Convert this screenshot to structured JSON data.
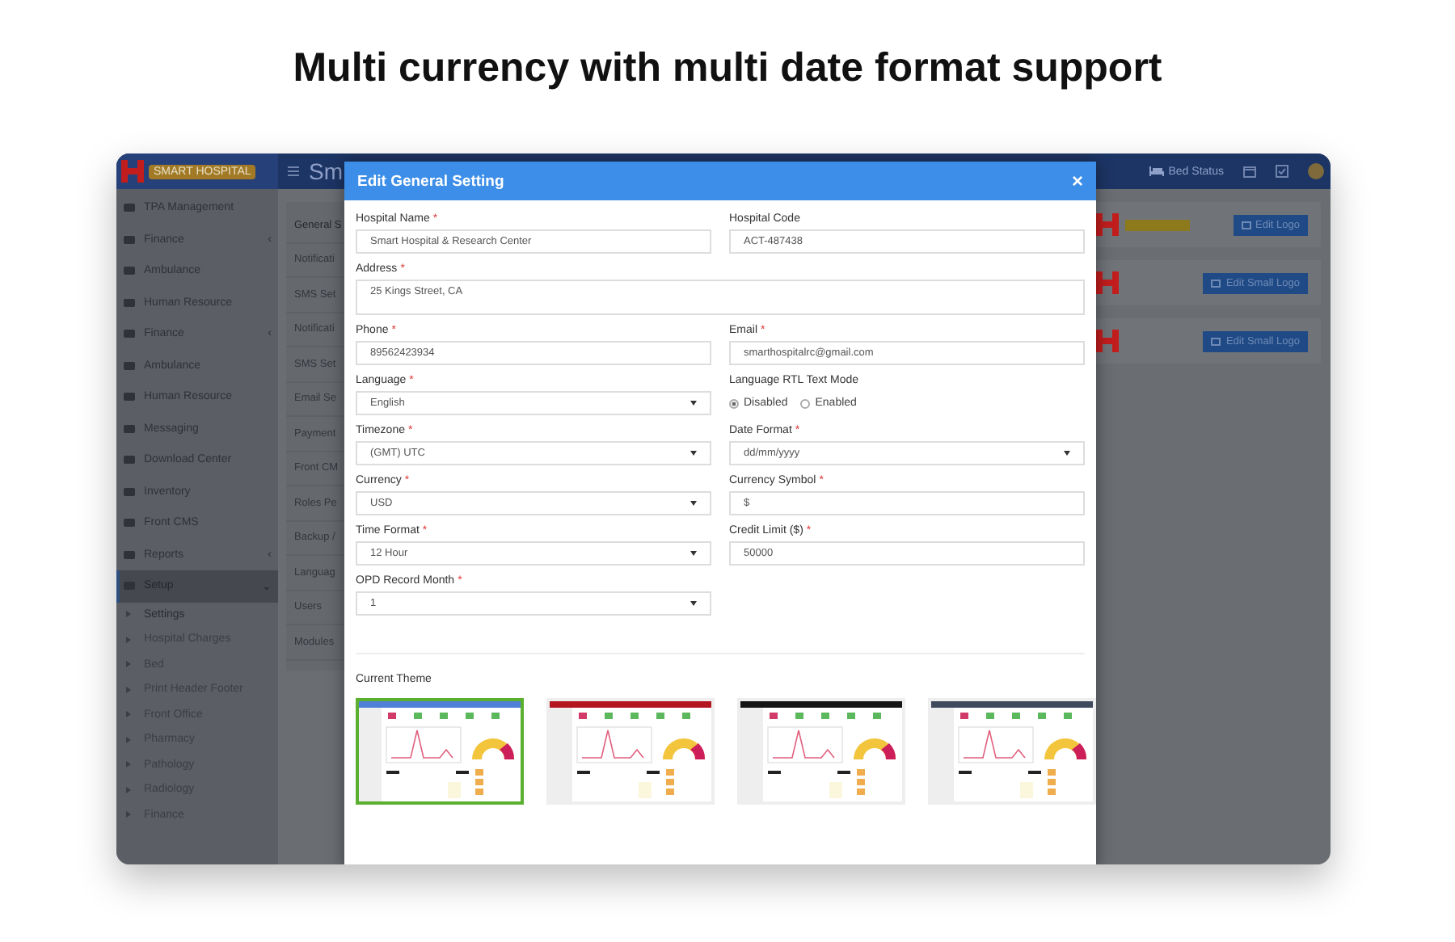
{
  "heading": "Multi currency with multi date format support",
  "app": {
    "logo_text": "SMART HOSPITAL",
    "page_title": "Sm",
    "bed_status": "Bed Status"
  },
  "sidebar": {
    "items": [
      {
        "label": "TPA Management",
        "selected": false
      },
      {
        "label": "Finance",
        "caret": "‹",
        "selected": false
      },
      {
        "label": "Ambulance",
        "selected": false
      },
      {
        "label": "Human Resource",
        "selected": false
      },
      {
        "label": "Finance",
        "caret": "‹",
        "selected": false
      },
      {
        "label": "Ambulance",
        "selected": false
      },
      {
        "label": "Human Resource",
        "selected": false
      },
      {
        "label": "Messaging",
        "selected": false
      },
      {
        "label": "Download Center",
        "selected": false
      },
      {
        "label": "Inventory",
        "selected": false
      },
      {
        "label": "Front CMS",
        "selected": false
      },
      {
        "label": "Reports",
        "caret": "‹",
        "selected": false
      },
      {
        "label": "Setup",
        "caret": "⌄",
        "selected": true,
        "expanded": true,
        "children": [
          {
            "label": "Settings",
            "selected": true
          },
          {
            "label": "Hospital Charges",
            "selected": false
          },
          {
            "label": "Bed",
            "selected": false
          },
          {
            "label": "Print Header Footer",
            "selected": false
          },
          {
            "label": "Front Office",
            "selected": false
          },
          {
            "label": "Pharmacy",
            "selected": false
          },
          {
            "label": "Pathology",
            "selected": false
          },
          {
            "label": "Radiology",
            "selected": false
          },
          {
            "label": "Finance",
            "selected": false
          }
        ]
      }
    ]
  },
  "settings_menu": [
    {
      "label": "General S",
      "selected": true
    },
    {
      "label": "Notificati",
      "selected": false
    },
    {
      "label": "SMS Set",
      "selected": false
    },
    {
      "label": "Notificati",
      "selected": false
    },
    {
      "label": "SMS Set",
      "selected": false
    },
    {
      "label": "Email Se",
      "selected": false
    },
    {
      "label": "Payment",
      "selected": false
    },
    {
      "label": "Front CM",
      "selected": false
    },
    {
      "label": "Roles Pe",
      "selected": false
    },
    {
      "label": "Backup /",
      "selected": false
    },
    {
      "label": "Languag",
      "selected": false
    },
    {
      "label": "Users",
      "selected": false
    },
    {
      "label": "Modules",
      "selected": false
    }
  ],
  "logo_cards": [
    {
      "button": "Edit Logo",
      "badge": true
    },
    {
      "button": "Edit Small Logo",
      "badge": false
    },
    {
      "button": "Edit Small Logo",
      "badge": false
    }
  ],
  "dialog": {
    "title": "Edit General Setting",
    "close": "×",
    "fields": [
      {
        "kind": "input",
        "label": "Hospital Name",
        "mark": "*",
        "value": "Smart Hospital & Research Center"
      },
      {
        "kind": "input",
        "label": "Hospital Code",
        "value": "ACT-487438"
      },
      {
        "kind": "textarea",
        "label": "Address",
        "mark": "*",
        "value": "25 Kings Street, CA"
      },
      {
        "kind": "input",
        "label": "Phone",
        "mark": "*",
        "value": "89562423934"
      },
      {
        "kind": "input",
        "label": "Email",
        "mark": "*",
        "value": "smarthospitalrc@gmail.com"
      },
      {
        "kind": "select",
        "label": "Language",
        "mark": "*",
        "value": "English"
      },
      {
        "kind": "radio",
        "label": "Language RTL Text Mode",
        "options": [
          {
            "label": "Disabled",
            "selected": true
          },
          {
            "label": "Enabled",
            "selected": false
          }
        ]
      },
      {
        "kind": "select",
        "label": "Timezone",
        "mark": "*",
        "value": "(GMT) UTC"
      },
      {
        "kind": "select",
        "label": "Date Format",
        "mark": "*",
        "value": "dd/mm/yyyy"
      },
      {
        "kind": "select",
        "label": "Currency",
        "mark": "*",
        "value": "USD"
      },
      {
        "kind": "input",
        "label": "Currency Symbol",
        "mark": "*",
        "value": "$"
      },
      {
        "kind": "select",
        "label": "Time Format",
        "mark": "*",
        "value": "12 Hour"
      },
      {
        "kind": "input",
        "label": "Credit Limit ($)",
        "mark": "*",
        "value": "50000"
      },
      {
        "kind": "select",
        "label": "OPD Record Month",
        "mark": "*",
        "value": "1"
      }
    ],
    "theme_label": "Current Theme",
    "themes": [
      {
        "color": "#4f7fd6",
        "selected": true
      },
      {
        "color": "#b3161e",
        "selected": false
      },
      {
        "color": "#151515",
        "selected": false
      },
      {
        "color": "#3f4a5c",
        "selected": false
      }
    ]
  }
}
